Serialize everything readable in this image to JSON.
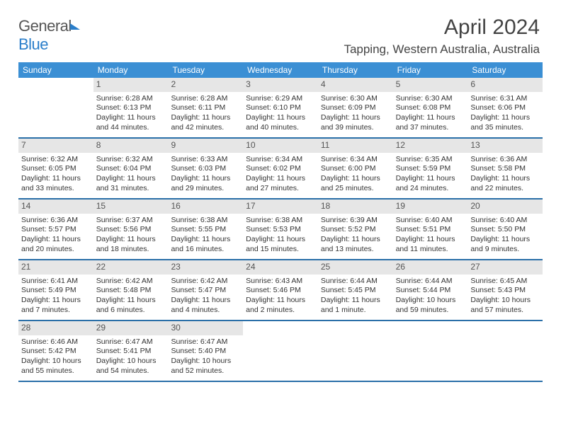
{
  "logo": {
    "part1": "General",
    "part2": "Blue"
  },
  "title": "April 2024",
  "subtitle": "Tapping, Western Australia, Australia",
  "dayHeaders": [
    "Sunday",
    "Monday",
    "Tuesday",
    "Wednesday",
    "Thursday",
    "Friday",
    "Saturday"
  ],
  "weeks": [
    [
      null,
      {
        "n": "1",
        "sr": "Sunrise: 6:28 AM",
        "ss": "Sunset: 6:13 PM",
        "d1": "Daylight: 11 hours",
        "d2": "and 44 minutes."
      },
      {
        "n": "2",
        "sr": "Sunrise: 6:28 AM",
        "ss": "Sunset: 6:11 PM",
        "d1": "Daylight: 11 hours",
        "d2": "and 42 minutes."
      },
      {
        "n": "3",
        "sr": "Sunrise: 6:29 AM",
        "ss": "Sunset: 6:10 PM",
        "d1": "Daylight: 11 hours",
        "d2": "and 40 minutes."
      },
      {
        "n": "4",
        "sr": "Sunrise: 6:30 AM",
        "ss": "Sunset: 6:09 PM",
        "d1": "Daylight: 11 hours",
        "d2": "and 39 minutes."
      },
      {
        "n": "5",
        "sr": "Sunrise: 6:30 AM",
        "ss": "Sunset: 6:08 PM",
        "d1": "Daylight: 11 hours",
        "d2": "and 37 minutes."
      },
      {
        "n": "6",
        "sr": "Sunrise: 6:31 AM",
        "ss": "Sunset: 6:06 PM",
        "d1": "Daylight: 11 hours",
        "d2": "and 35 minutes."
      }
    ],
    [
      {
        "n": "7",
        "sr": "Sunrise: 6:32 AM",
        "ss": "Sunset: 6:05 PM",
        "d1": "Daylight: 11 hours",
        "d2": "and 33 minutes."
      },
      {
        "n": "8",
        "sr": "Sunrise: 6:32 AM",
        "ss": "Sunset: 6:04 PM",
        "d1": "Daylight: 11 hours",
        "d2": "and 31 minutes."
      },
      {
        "n": "9",
        "sr": "Sunrise: 6:33 AM",
        "ss": "Sunset: 6:03 PM",
        "d1": "Daylight: 11 hours",
        "d2": "and 29 minutes."
      },
      {
        "n": "10",
        "sr": "Sunrise: 6:34 AM",
        "ss": "Sunset: 6:02 PM",
        "d1": "Daylight: 11 hours",
        "d2": "and 27 minutes."
      },
      {
        "n": "11",
        "sr": "Sunrise: 6:34 AM",
        "ss": "Sunset: 6:00 PM",
        "d1": "Daylight: 11 hours",
        "d2": "and 25 minutes."
      },
      {
        "n": "12",
        "sr": "Sunrise: 6:35 AM",
        "ss": "Sunset: 5:59 PM",
        "d1": "Daylight: 11 hours",
        "d2": "and 24 minutes."
      },
      {
        "n": "13",
        "sr": "Sunrise: 6:36 AM",
        "ss": "Sunset: 5:58 PM",
        "d1": "Daylight: 11 hours",
        "d2": "and 22 minutes."
      }
    ],
    [
      {
        "n": "14",
        "sr": "Sunrise: 6:36 AM",
        "ss": "Sunset: 5:57 PM",
        "d1": "Daylight: 11 hours",
        "d2": "and 20 minutes."
      },
      {
        "n": "15",
        "sr": "Sunrise: 6:37 AM",
        "ss": "Sunset: 5:56 PM",
        "d1": "Daylight: 11 hours",
        "d2": "and 18 minutes."
      },
      {
        "n": "16",
        "sr": "Sunrise: 6:38 AM",
        "ss": "Sunset: 5:55 PM",
        "d1": "Daylight: 11 hours",
        "d2": "and 16 minutes."
      },
      {
        "n": "17",
        "sr": "Sunrise: 6:38 AM",
        "ss": "Sunset: 5:53 PM",
        "d1": "Daylight: 11 hours",
        "d2": "and 15 minutes."
      },
      {
        "n": "18",
        "sr": "Sunrise: 6:39 AM",
        "ss": "Sunset: 5:52 PM",
        "d1": "Daylight: 11 hours",
        "d2": "and 13 minutes."
      },
      {
        "n": "19",
        "sr": "Sunrise: 6:40 AM",
        "ss": "Sunset: 5:51 PM",
        "d1": "Daylight: 11 hours",
        "d2": "and 11 minutes."
      },
      {
        "n": "20",
        "sr": "Sunrise: 6:40 AM",
        "ss": "Sunset: 5:50 PM",
        "d1": "Daylight: 11 hours",
        "d2": "and 9 minutes."
      }
    ],
    [
      {
        "n": "21",
        "sr": "Sunrise: 6:41 AM",
        "ss": "Sunset: 5:49 PM",
        "d1": "Daylight: 11 hours",
        "d2": "and 7 minutes."
      },
      {
        "n": "22",
        "sr": "Sunrise: 6:42 AM",
        "ss": "Sunset: 5:48 PM",
        "d1": "Daylight: 11 hours",
        "d2": "and 6 minutes."
      },
      {
        "n": "23",
        "sr": "Sunrise: 6:42 AM",
        "ss": "Sunset: 5:47 PM",
        "d1": "Daylight: 11 hours",
        "d2": "and 4 minutes."
      },
      {
        "n": "24",
        "sr": "Sunrise: 6:43 AM",
        "ss": "Sunset: 5:46 PM",
        "d1": "Daylight: 11 hours",
        "d2": "and 2 minutes."
      },
      {
        "n": "25",
        "sr": "Sunrise: 6:44 AM",
        "ss": "Sunset: 5:45 PM",
        "d1": "Daylight: 11 hours",
        "d2": "and 1 minute."
      },
      {
        "n": "26",
        "sr": "Sunrise: 6:44 AM",
        "ss": "Sunset: 5:44 PM",
        "d1": "Daylight: 10 hours",
        "d2": "and 59 minutes."
      },
      {
        "n": "27",
        "sr": "Sunrise: 6:45 AM",
        "ss": "Sunset: 5:43 PM",
        "d1": "Daylight: 10 hours",
        "d2": "and 57 minutes."
      }
    ],
    [
      {
        "n": "28",
        "sr": "Sunrise: 6:46 AM",
        "ss": "Sunset: 5:42 PM",
        "d1": "Daylight: 10 hours",
        "d2": "and 55 minutes."
      },
      {
        "n": "29",
        "sr": "Sunrise: 6:47 AM",
        "ss": "Sunset: 5:41 PM",
        "d1": "Daylight: 10 hours",
        "d2": "and 54 minutes."
      },
      {
        "n": "30",
        "sr": "Sunrise: 6:47 AM",
        "ss": "Sunset: 5:40 PM",
        "d1": "Daylight: 10 hours",
        "d2": "and 52 minutes."
      },
      null,
      null,
      null,
      null
    ]
  ]
}
